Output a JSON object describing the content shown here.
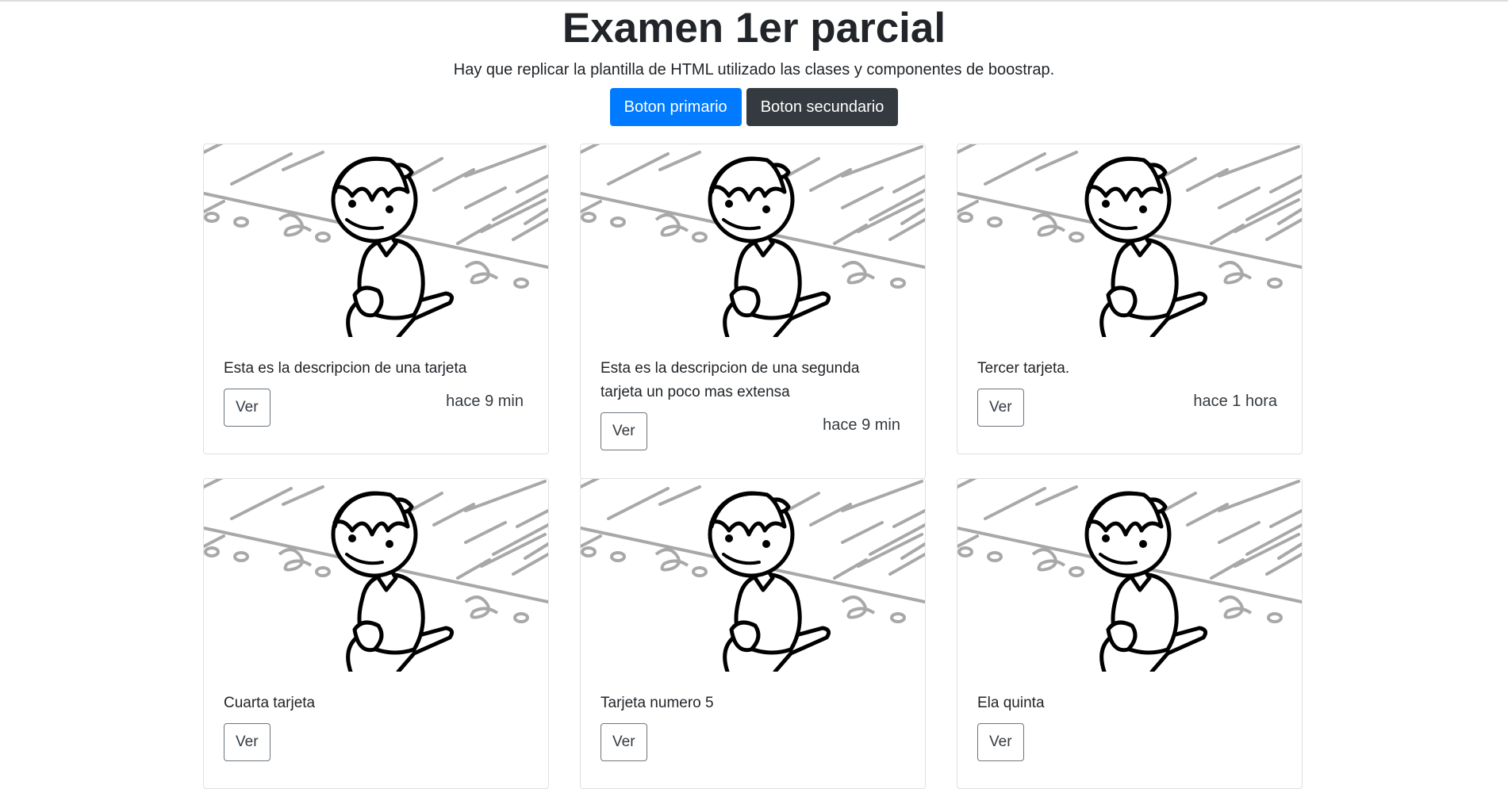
{
  "header": {
    "title": "Examen 1er parcial",
    "subtitle": "Hay que replicar la plantilla de HTML utilizado las clases y componentes de boostrap.",
    "primary_button": "Boton primario",
    "secondary_button": "Boton secundario"
  },
  "cards": [
    {
      "text": "Esta es la descripcion de una tarjeta",
      "button": "Ver",
      "time": "hace 9 min"
    },
    {
      "text": "Esta es la descripcion de una segunda tarjeta un poco mas extensa",
      "button": "Ver",
      "time": "hace 9 min"
    },
    {
      "text": "Tercer tarjeta.",
      "button": "Ver",
      "time": "hace 1 hora"
    },
    {
      "text": "Cuarta tarjeta",
      "button": "Ver",
      "time": ""
    },
    {
      "text": "Tarjeta numero 5",
      "button": "Ver",
      "time": ""
    },
    {
      "text": "Ela quinta",
      "button": "Ver",
      "time": ""
    }
  ],
  "colors": {
    "primary": "#007bff",
    "secondary": "#343a40",
    "text": "#212529"
  }
}
